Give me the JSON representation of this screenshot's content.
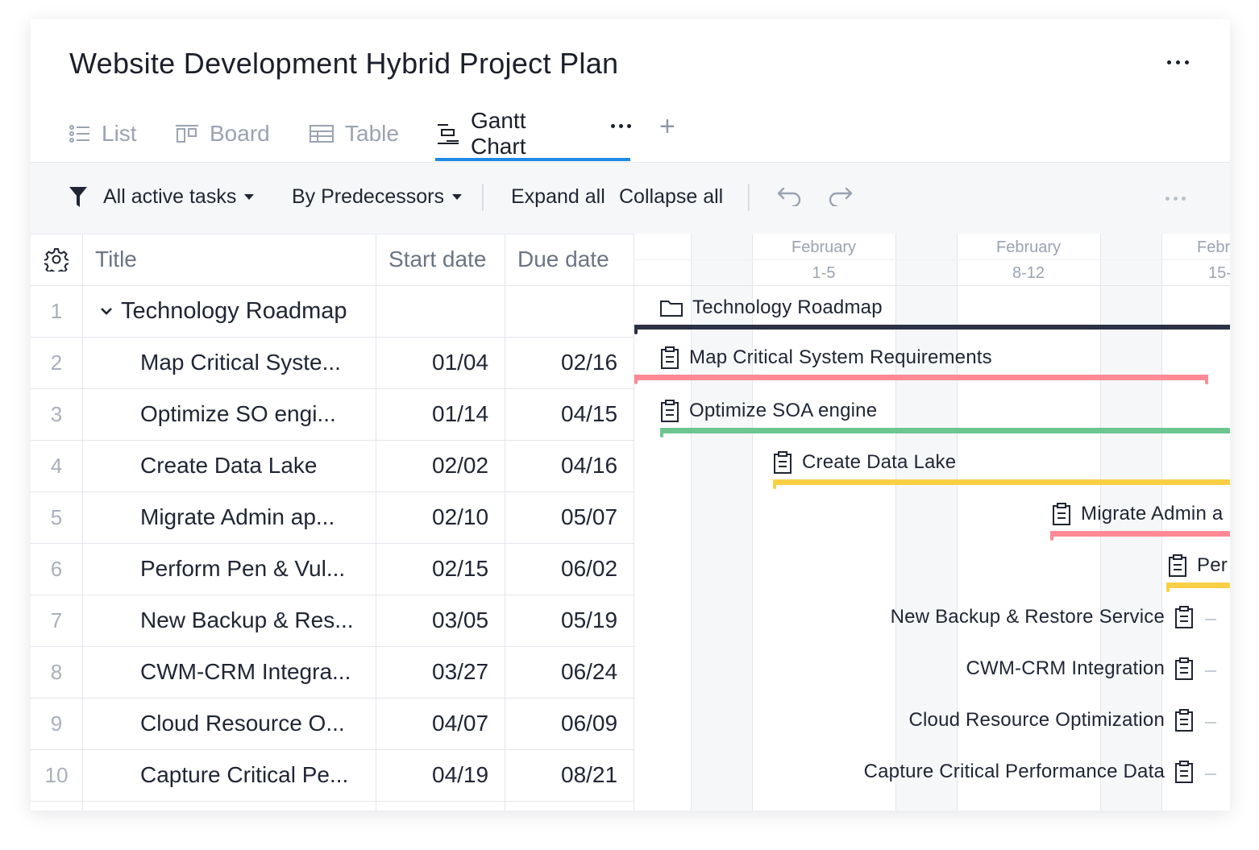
{
  "page": {
    "title": "Website Development Hybrid Project Plan",
    "more_icon": "more-horizontal-icon"
  },
  "tabs": [
    {
      "label": "List",
      "icon": "list-icon",
      "active": false
    },
    {
      "label": "Board",
      "icon": "board-icon",
      "active": false
    },
    {
      "label": "Table",
      "icon": "table-icon",
      "active": false
    },
    {
      "label": "Gantt Chart",
      "icon": "gantt-icon",
      "active": true
    }
  ],
  "toolbar": {
    "filter_label": "All active tasks",
    "group_label": "By Predecessors",
    "expand_label": "Expand all",
    "collapse_label": "Collapse all"
  },
  "grid": {
    "columns": {
      "title": "Title",
      "start": "Start date",
      "due": "Due date"
    },
    "rows": [
      {
        "num": "1",
        "title": "Technology Roadmap",
        "start": "",
        "due": "",
        "is_group": true
      },
      {
        "num": "2",
        "title": "Map Critical Syste...",
        "start": "01/04",
        "due": "02/16"
      },
      {
        "num": "3",
        "title": "Optimize SO engi...",
        "start": "01/14",
        "due": "04/15"
      },
      {
        "num": "4",
        "title": "Create Data Lake",
        "start": "02/02",
        "due": "04/16"
      },
      {
        "num": "5",
        "title": "Migrate Admin ap...",
        "start": "02/10",
        "due": "05/07"
      },
      {
        "num": "6",
        "title": "Perform Pen & Vul...",
        "start": "02/15",
        "due": "06/02"
      },
      {
        "num": "7",
        "title": "New Backup & Res...",
        "start": "03/05",
        "due": "05/19"
      },
      {
        "num": "8",
        "title": "CWM-CRM Integra...",
        "start": "03/27",
        "due": "06/24"
      },
      {
        "num": "9",
        "title": "Cloud Resource O...",
        "start": "04/07",
        "due": "06/09"
      },
      {
        "num": "10",
        "title": "Capture Critical Pe...",
        "start": "04/19",
        "due": "08/21"
      }
    ]
  },
  "gantt": {
    "weeks": [
      {
        "month": "February",
        "range": "1-5"
      },
      {
        "month": "February",
        "range": "8-12"
      },
      {
        "month": "Febr",
        "range": "15-"
      }
    ],
    "items": [
      {
        "label": "Technology Roadmap",
        "icon": "folder-icon",
        "color": "#2b3245"
      },
      {
        "label": "Map Critical System Requirements",
        "icon": "clipboard-icon",
        "color": "#ff8a95"
      },
      {
        "label": "Optimize SOA engine",
        "icon": "clipboard-icon",
        "color": "#6cc691"
      },
      {
        "label": "Create Data Lake",
        "icon": "clipboard-icon",
        "color": "#f9cf45"
      },
      {
        "label": "Migrate Admin a",
        "icon": "clipboard-icon",
        "color": "#ff8a95"
      },
      {
        "label": "Per",
        "icon": "clipboard-icon",
        "color": "#f9cf45"
      },
      {
        "label": "New Backup & Restore Service",
        "icon": "clipboard-icon"
      },
      {
        "label": "CWM-CRM Integration",
        "icon": "clipboard-icon"
      },
      {
        "label": "Cloud Resource Optimization",
        "icon": "clipboard-icon"
      },
      {
        "label": "Capture Critical Performance Data",
        "icon": "clipboard-icon"
      }
    ]
  }
}
